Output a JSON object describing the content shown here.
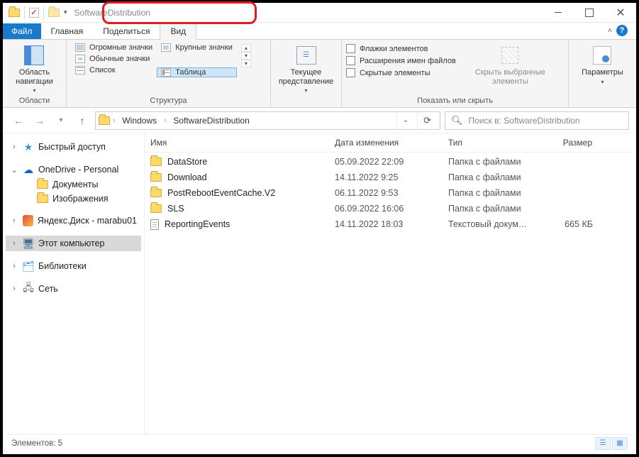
{
  "title": "SoftwareDistribution",
  "tabs": {
    "file": "Файл",
    "home": "Главная",
    "share": "Поделиться",
    "view": "Вид"
  },
  "ribbon": {
    "nav": {
      "panes": "Область\nнавигации",
      "group": "Области"
    },
    "layout": {
      "huge": "Огромные значки",
      "large": "Крупные значки",
      "normal": "Обычные значки",
      "list": "Список",
      "table": "Таблица",
      "group": "Структура"
    },
    "current": {
      "btn": "Текущее\nпредставление"
    },
    "show": {
      "checkboxes": "Флажки элементов",
      "extensions": "Расширения имен файлов",
      "hidden": "Скрытые элементы",
      "hide_btn": "Скрыть выбранные\nэлементы",
      "group": "Показать или скрыть"
    },
    "options": {
      "btn": "Параметры"
    }
  },
  "breadcrumb": {
    "a": "Windows",
    "b": "SoftwareDistribution"
  },
  "search_placeholder": "Поиск в: SoftwareDistribution",
  "tree": {
    "quick": "Быстрый доступ",
    "onedrive": "OneDrive - Personal",
    "docs": "Документы",
    "pics": "Изображения",
    "ydisk": "Яндекс.Диск - marabu01",
    "pc": "Этот компьютер",
    "libs": "Библиотеки",
    "net": "Сеть"
  },
  "columns": {
    "name": "Имя",
    "date": "Дата изменения",
    "type": "Тип",
    "size": "Размер"
  },
  "rows": [
    {
      "name": "DataStore",
      "date": "05.09.2022 22:09",
      "type": "Папка с файлами",
      "size": "",
      "kind": "folder"
    },
    {
      "name": "Download",
      "date": "14.11.2022 9:25",
      "type": "Папка с файлами",
      "size": "",
      "kind": "folder"
    },
    {
      "name": "PostRebootEventCache.V2",
      "date": "06.11.2022 9:53",
      "type": "Папка с файлами",
      "size": "",
      "kind": "folder"
    },
    {
      "name": "SLS",
      "date": "06.09.2022 16:06",
      "type": "Папка с файлами",
      "size": "",
      "kind": "folder"
    },
    {
      "name": "ReportingEvents",
      "date": "14.11.2022 18:03",
      "type": "Текстовый докум…",
      "size": "665 КБ",
      "kind": "file"
    }
  ],
  "status": "Элементов: 5"
}
